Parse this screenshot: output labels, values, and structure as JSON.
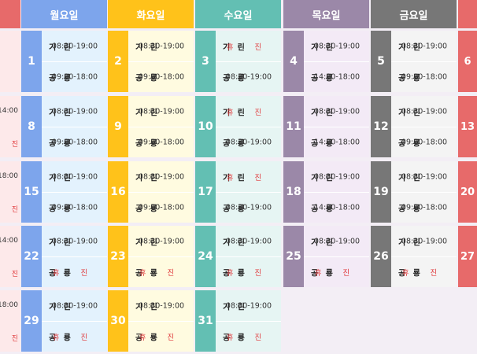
{
  "colors": {
    "mon": "#7da5ec",
    "tue": "#ffc21a",
    "wed": "#63bfb3",
    "thu": "#9b88a8",
    "fri": "#777777",
    "sun": "#e76a6a",
    "sat": "#e76a6a",
    "mon_bg": "#e3f2fd",
    "tue_bg": "#fffbe0",
    "wed_bg": "#e6f5f3",
    "thu_bg": "#f3eaf6",
    "fri_bg": "#f4f4f4",
    "sun_bg": "#fde9ea",
    "off": "#e0393b"
  },
  "header": {
    "mon": "월요일",
    "tue": "화요일",
    "wed": "수요일",
    "thu": "목요일",
    "fri": "금요일"
  },
  "labels": {
    "a": "기 린",
    "b": "공 룡",
    "holiday": "휴 진"
  },
  "weeks": [
    {
      "left": null,
      "mon": {
        "d": "1",
        "a": "08:30-19:00",
        "b": "09:00-18:00"
      },
      "tue": {
        "d": "2",
        "a": "08:30-19:00",
        "b": "09:00-18:00"
      },
      "wed": {
        "d": "3",
        "a": "휴 진",
        "b": "08:30-19:00"
      },
      "thu": {
        "d": "4",
        "a": "08:30-19:00",
        "b": "14:00-18:00"
      },
      "fri": {
        "d": "5",
        "a": "08:30-19:00",
        "b": "09:00-18:00"
      },
      "right": "6"
    },
    {
      "left": {
        "a": "-14:00",
        "b": "진"
      },
      "mon": {
        "d": "8",
        "a": "08:30-19:00",
        "b": "09:00-18:00"
      },
      "tue": {
        "d": "9",
        "a": "08:30-19:00",
        "b": "09:00-18:00"
      },
      "wed": {
        "d": "10",
        "a": "휴 진",
        "b": "08:30-19:00"
      },
      "thu": {
        "d": "11",
        "a": "08:30-19:00",
        "b": "14:00-18:00"
      },
      "fri": {
        "d": "12",
        "a": "08:30-19:00",
        "b": "09:00-18:00"
      },
      "right": "13"
    },
    {
      "left": {
        "a": "-18:00",
        "b": "진"
      },
      "mon": {
        "d": "15",
        "a": "08:30-19:00",
        "b": "09:00-18:00"
      },
      "tue": {
        "d": "16",
        "a": "08:30-19:00",
        "b": "09:00-18:00"
      },
      "wed": {
        "d": "17",
        "a": "휴 진",
        "b": "08:30-19:00"
      },
      "thu": {
        "d": "18",
        "a": "08:30-19:00",
        "b": "14:00-18:00"
      },
      "fri": {
        "d": "19",
        "a": "08:30-19:00",
        "b": "09:00-18:00"
      },
      "right": "20"
    },
    {
      "left": {
        "a": "-14:00",
        "b": "진"
      },
      "mon": {
        "d": "22",
        "a": "08:30-19:00",
        "b": "휴 진"
      },
      "tue": {
        "d": "23",
        "a": "08:30-19:00",
        "b": "휴 진"
      },
      "wed": {
        "d": "24",
        "a": "08:30-19:00",
        "b": "휴 진"
      },
      "thu": {
        "d": "25",
        "a": "08:30-19:00",
        "b": "휴 진"
      },
      "fri": {
        "d": "26",
        "a": "08:30-19:00",
        "b": "휴 진"
      },
      "right": "27"
    },
    {
      "left": {
        "a": "-18:00",
        "b": "진"
      },
      "mon": {
        "d": "29",
        "a": "08:30-19:00",
        "b": "휴 진"
      },
      "tue": {
        "d": "30",
        "a": "08:30-19:00",
        "b": "휴 진"
      },
      "wed": {
        "d": "31",
        "a": "08:30-19:00",
        "b": "휴 진"
      },
      "thu": null,
      "fri": null,
      "right": null
    }
  ]
}
